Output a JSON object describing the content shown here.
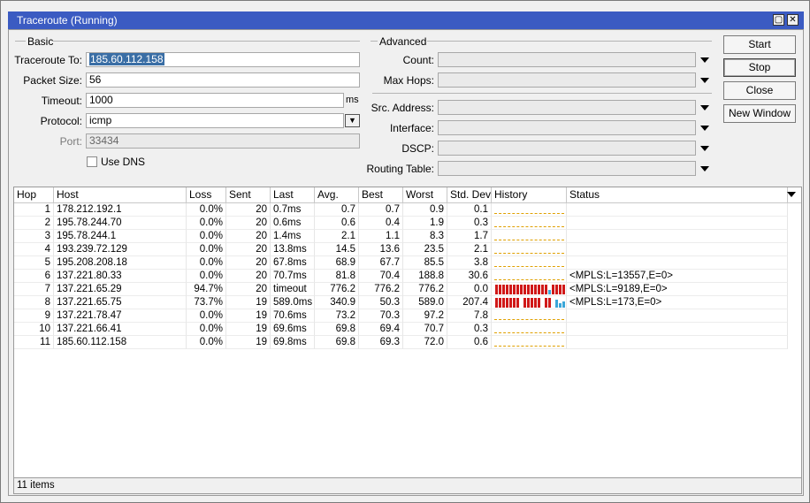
{
  "window": {
    "title": "Traceroute (Running)"
  },
  "basic": {
    "group_label": "Basic",
    "traceroute_to_label": "Traceroute To:",
    "traceroute_to_value": "185.60.112.158",
    "packet_size_label": "Packet Size:",
    "packet_size_value": "56",
    "timeout_label": "Timeout:",
    "timeout_value": "1000",
    "timeout_unit": "ms",
    "protocol_label": "Protocol:",
    "protocol_value": "icmp",
    "port_label": "Port:",
    "port_value": "33434",
    "use_dns_label": "Use DNS"
  },
  "advanced": {
    "group_label": "Advanced",
    "count_label": "Count:",
    "max_hops_label": "Max Hops:",
    "src_address_label": "Src. Address:",
    "interface_label": "Interface:",
    "dscp_label": "DSCP:",
    "routing_table_label": "Routing Table:"
  },
  "buttons": {
    "start": "Start",
    "stop": "Stop",
    "close": "Close",
    "new_window": "New Window"
  },
  "table": {
    "columns": [
      "Hop",
      "Host",
      "Loss",
      "Sent",
      "Last",
      "Avg.",
      "Best",
      "Worst",
      "Std. Dev.",
      "History",
      "Status"
    ],
    "rows": [
      {
        "hop": "1",
        "host": "178.212.192.1",
        "loss": "0.0%",
        "sent": "20",
        "last": "0.7ms",
        "avg": "0.7",
        "best": "0.7",
        "worst": "0.9",
        "std": "0.1",
        "status": "",
        "history": "ok"
      },
      {
        "hop": "2",
        "host": "195.78.244.70",
        "loss": "0.0%",
        "sent": "20",
        "last": "0.6ms",
        "avg": "0.6",
        "best": "0.4",
        "worst": "1.9",
        "std": "0.3",
        "status": "",
        "history": "ok"
      },
      {
        "hop": "3",
        "host": "195.78.244.1",
        "loss": "0.0%",
        "sent": "20",
        "last": "1.4ms",
        "avg": "2.1",
        "best": "1.1",
        "worst": "8.3",
        "std": "1.7",
        "status": "",
        "history": "ok"
      },
      {
        "hop": "4",
        "host": "193.239.72.129",
        "loss": "0.0%",
        "sent": "20",
        "last": "13.8ms",
        "avg": "14.5",
        "best": "13.6",
        "worst": "23.5",
        "std": "2.1",
        "status": "",
        "history": "ok"
      },
      {
        "hop": "5",
        "host": "195.208.208.18",
        "loss": "0.0%",
        "sent": "20",
        "last": "67.8ms",
        "avg": "68.9",
        "best": "67.7",
        "worst": "85.5",
        "std": "3.8",
        "status": "",
        "history": "ok"
      },
      {
        "hop": "6",
        "host": "137.221.80.33",
        "loss": "0.0%",
        "sent": "20",
        "last": "70.7ms",
        "avg": "81.8",
        "best": "70.4",
        "worst": "188.8",
        "std": "30.6",
        "status": "<MPLS:L=13557,E=0>",
        "history": "ok"
      },
      {
        "hop": "7",
        "host": "137.221.65.29",
        "loss": "94.7%",
        "sent": "20",
        "last": "timeout",
        "avg": "776.2",
        "best": "776.2",
        "worst": "776.2",
        "std": "0.0",
        "status": "<MPLS:L=9189,E=0>",
        "history": "loss"
      },
      {
        "hop": "8",
        "host": "137.221.65.75",
        "loss": "73.7%",
        "sent": "19",
        "last": "589.0ms",
        "avg": "340.9",
        "best": "50.3",
        "worst": "589.0",
        "std": "207.4",
        "status": "<MPLS:L=173,E=0>",
        "history": "mixed"
      },
      {
        "hop": "9",
        "host": "137.221.78.47",
        "loss": "0.0%",
        "sent": "19",
        "last": "70.6ms",
        "avg": "73.2",
        "best": "70.3",
        "worst": "97.2",
        "std": "7.8",
        "status": "",
        "history": "ok"
      },
      {
        "hop": "10",
        "host": "137.221.66.41",
        "loss": "0.0%",
        "sent": "19",
        "last": "69.6ms",
        "avg": "69.8",
        "best": "69.4",
        "worst": "70.7",
        "std": "0.3",
        "status": "",
        "history": "ok"
      },
      {
        "hop": "11",
        "host": "185.60.112.158",
        "loss": "0.0%",
        "sent": "19",
        "last": "69.8ms",
        "avg": "69.8",
        "best": "69.3",
        "worst": "72.0",
        "std": "0.6",
        "status": "",
        "history": "ok"
      }
    ]
  },
  "status_bar": {
    "items_count": "11 items"
  },
  "colors": {
    "titlebar": "#3b5bc2",
    "history_loss": "#d01818",
    "history_ok": "#3aa6d8",
    "history_line": "#e0a000"
  }
}
